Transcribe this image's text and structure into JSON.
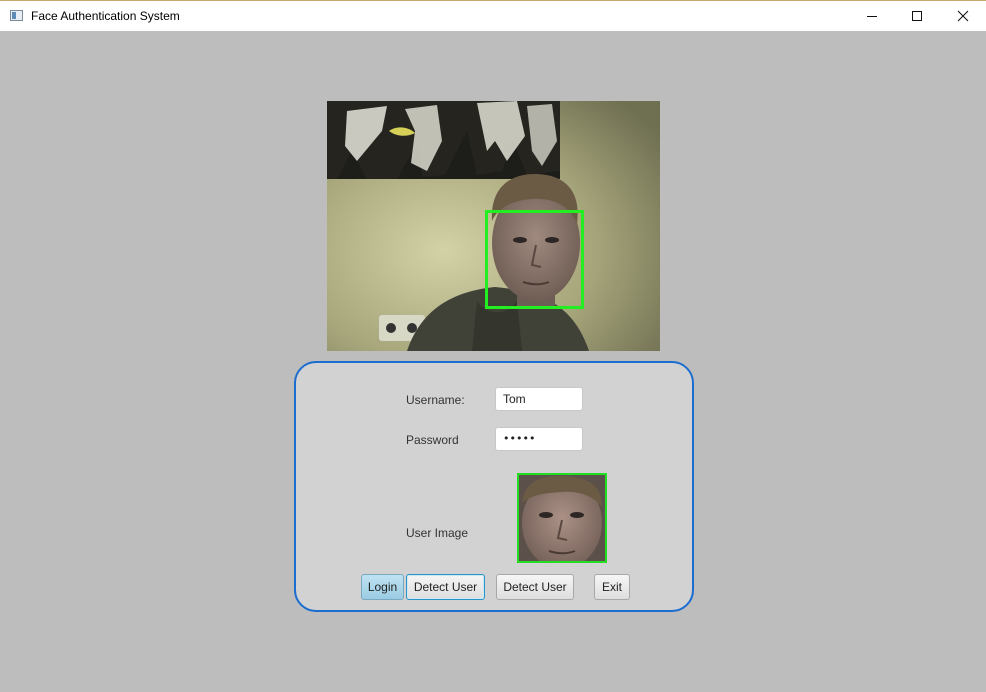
{
  "window": {
    "title": "Face Authentication System",
    "icon": "app-window-icon",
    "controls": [
      "minimize-icon",
      "maximize-icon",
      "close-icon"
    ]
  },
  "camera": {
    "face_box_color": "#22ee22"
  },
  "form": {
    "border_color": "#1c6dd0",
    "username_label": "Username:",
    "username_value": "Tom",
    "password_label": "Password",
    "password_value": "•••••",
    "user_image_label": "User Image"
  },
  "buttons": {
    "login": "Login",
    "detect_user_1": "Detect User",
    "detect_user_2": "Detect User",
    "exit": "Exit"
  }
}
